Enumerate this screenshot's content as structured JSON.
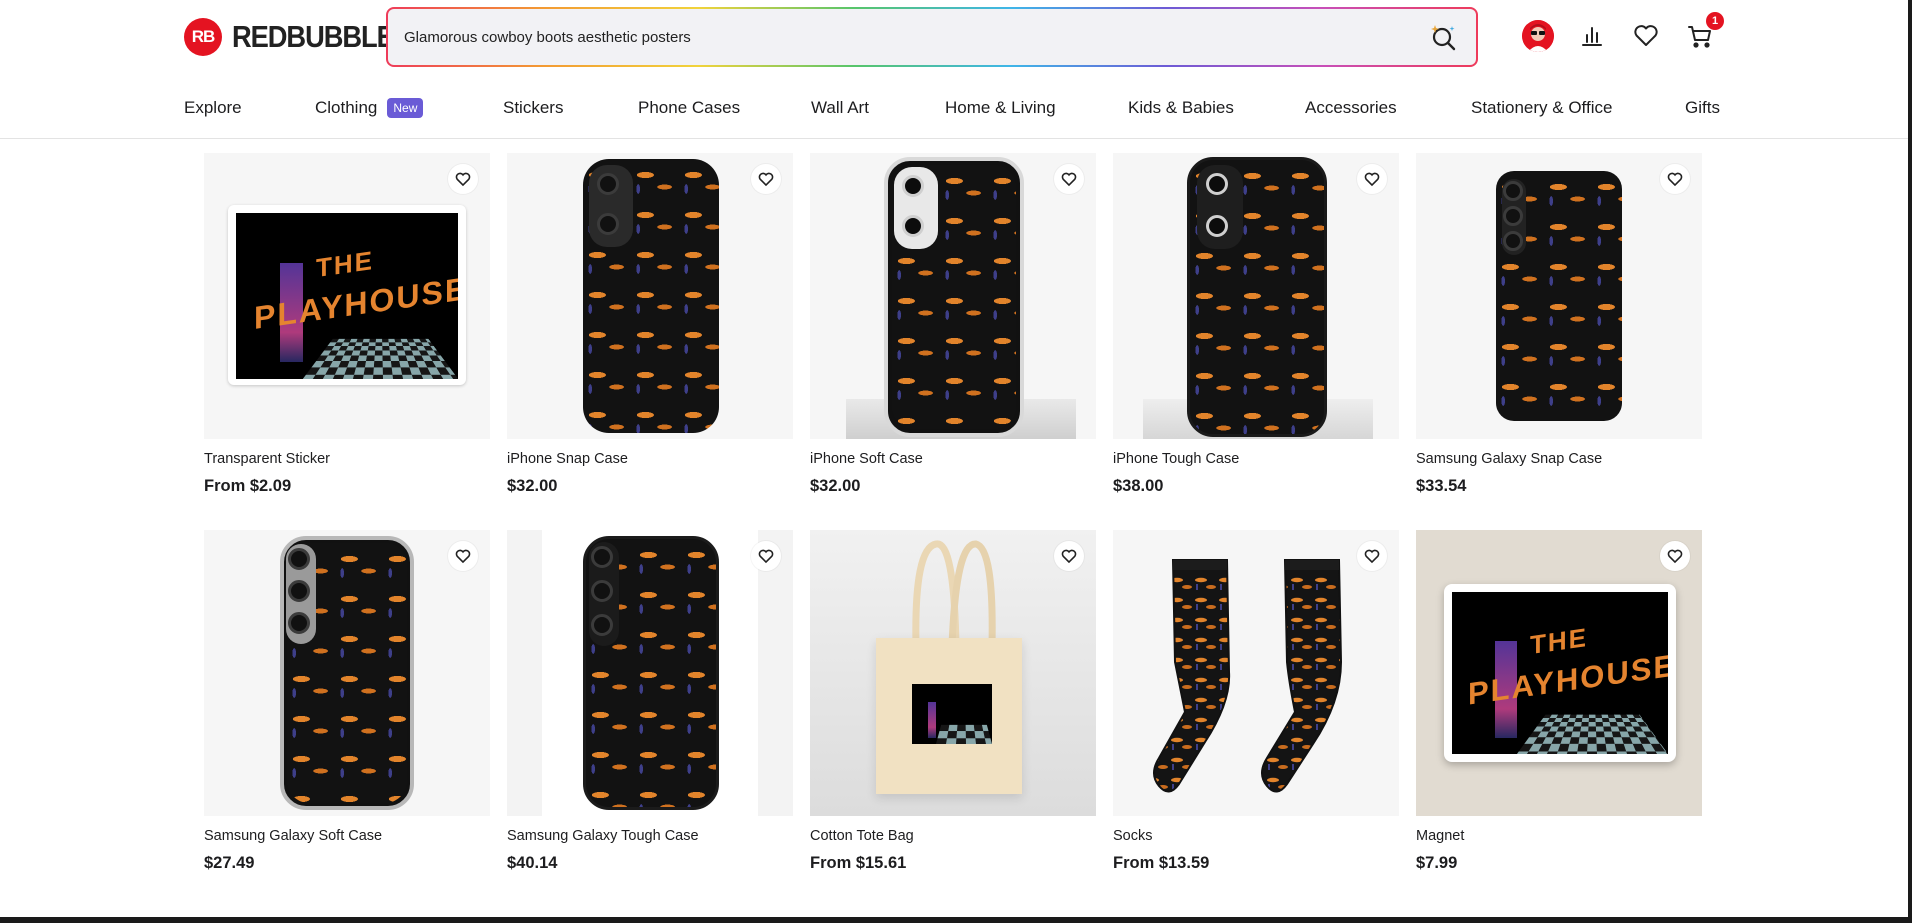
{
  "header": {
    "logo_mark": "RB",
    "logo_text": "REDBUBBLE",
    "search_value": "Glamorous cowboy boots aesthetic posters",
    "cart_count": "1",
    "accent_color": "#e41321"
  },
  "nav": {
    "items": [
      {
        "label": "Explore"
      },
      {
        "label": "Clothing",
        "badge": "New"
      },
      {
        "label": "Stickers"
      },
      {
        "label": "Phone Cases"
      },
      {
        "label": "Wall Art"
      },
      {
        "label": "Home & Living"
      },
      {
        "label": "Kids & Babies"
      },
      {
        "label": "Accessories"
      },
      {
        "label": "Stationery & Office"
      },
      {
        "label": "Gifts"
      }
    ]
  },
  "products": [
    {
      "title": "Transparent Sticker",
      "price": "From $2.09",
      "image": "sticker"
    },
    {
      "title": "iPhone Snap Case",
      "price": "$32.00",
      "image": "iphone-snap"
    },
    {
      "title": "iPhone Soft Case",
      "price": "$32.00",
      "image": "iphone-soft"
    },
    {
      "title": "iPhone Tough Case",
      "price": "$38.00",
      "image": "iphone-tough"
    },
    {
      "title": "Samsung Galaxy Snap Case",
      "price": "$33.54",
      "image": "samsung-snap"
    },
    {
      "title": "Samsung Galaxy Soft Case",
      "price": "$27.49",
      "image": "samsung-soft"
    },
    {
      "title": "Samsung Galaxy Tough Case",
      "price": "$40.14",
      "image": "samsung-tough"
    },
    {
      "title": "Cotton Tote Bag",
      "price": "From $15.61",
      "image": "tote"
    },
    {
      "title": "Socks",
      "price": "From $13.59",
      "image": "socks"
    },
    {
      "title": "Magnet",
      "price": "$7.99",
      "image": "magnet"
    }
  ],
  "artwork_text": {
    "line1": "THE",
    "line2": "PLAYHOUSE"
  },
  "icons": {
    "search": "search-sparkle-icon",
    "account": "avatar-icon",
    "dashboard": "bar-chart-icon",
    "favorites": "heart-icon",
    "cart": "cart-icon",
    "card_favorite": "heart-outline-icon"
  }
}
